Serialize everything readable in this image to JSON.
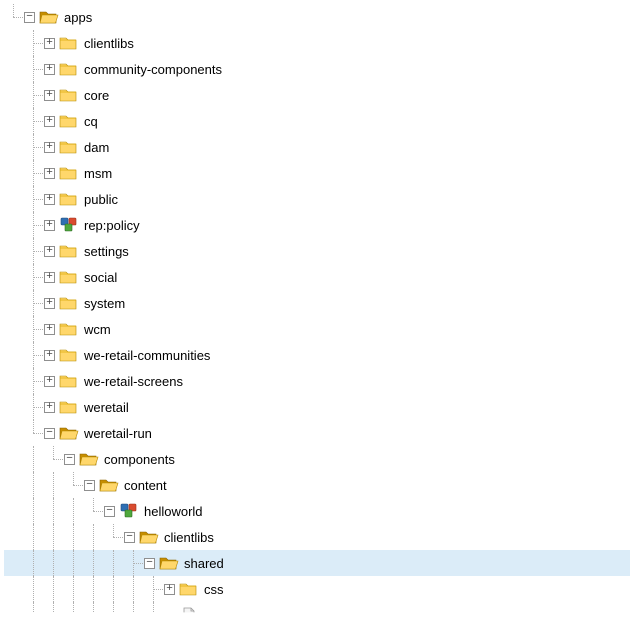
{
  "tree": [
    {
      "depth": 0,
      "toggle": "minus",
      "icon": "folder-open",
      "label": "apps",
      "guides": [],
      "join": "last"
    },
    {
      "depth": 1,
      "toggle": "plus",
      "icon": "folder",
      "label": "clientlibs",
      "guides": [
        "blank"
      ],
      "join": "tee"
    },
    {
      "depth": 1,
      "toggle": "plus",
      "icon": "folder",
      "label": "community-components",
      "guides": [
        "blank"
      ],
      "join": "tee"
    },
    {
      "depth": 1,
      "toggle": "plus",
      "icon": "folder",
      "label": "core",
      "guides": [
        "blank"
      ],
      "join": "tee"
    },
    {
      "depth": 1,
      "toggle": "plus",
      "icon": "folder",
      "label": "cq",
      "guides": [
        "blank"
      ],
      "join": "tee"
    },
    {
      "depth": 1,
      "toggle": "plus",
      "icon": "folder",
      "label": "dam",
      "guides": [
        "blank"
      ],
      "join": "tee"
    },
    {
      "depth": 1,
      "toggle": "plus",
      "icon": "folder",
      "label": "msm",
      "guides": [
        "blank"
      ],
      "join": "tee"
    },
    {
      "depth": 1,
      "toggle": "plus",
      "icon": "folder",
      "label": "public",
      "guides": [
        "blank"
      ],
      "join": "tee"
    },
    {
      "depth": 1,
      "toggle": "plus",
      "icon": "policy",
      "label": "rep:policy",
      "guides": [
        "blank"
      ],
      "join": "tee"
    },
    {
      "depth": 1,
      "toggle": "plus",
      "icon": "folder",
      "label": "settings",
      "guides": [
        "blank"
      ],
      "join": "tee"
    },
    {
      "depth": 1,
      "toggle": "plus",
      "icon": "folder",
      "label": "social",
      "guides": [
        "blank"
      ],
      "join": "tee"
    },
    {
      "depth": 1,
      "toggle": "plus",
      "icon": "folder",
      "label": "system",
      "guides": [
        "blank"
      ],
      "join": "tee"
    },
    {
      "depth": 1,
      "toggle": "plus",
      "icon": "folder",
      "label": "wcm",
      "guides": [
        "blank"
      ],
      "join": "tee"
    },
    {
      "depth": 1,
      "toggle": "plus",
      "icon": "folder",
      "label": "we-retail-communities",
      "guides": [
        "blank"
      ],
      "join": "tee"
    },
    {
      "depth": 1,
      "toggle": "plus",
      "icon": "folder",
      "label": "we-retail-screens",
      "guides": [
        "blank"
      ],
      "join": "tee"
    },
    {
      "depth": 1,
      "toggle": "plus",
      "icon": "folder",
      "label": "weretail",
      "guides": [
        "blank"
      ],
      "join": "tee"
    },
    {
      "depth": 1,
      "toggle": "minus",
      "icon": "folder-open",
      "label": "weretail-run",
      "guides": [
        "blank"
      ],
      "join": "last"
    },
    {
      "depth": 2,
      "toggle": "minus",
      "icon": "folder-open",
      "label": "components",
      "guides": [
        "blank",
        "line"
      ],
      "join": "last"
    },
    {
      "depth": 3,
      "toggle": "minus",
      "icon": "folder-open",
      "label": "content",
      "guides": [
        "blank",
        "line",
        "line"
      ],
      "join": "last"
    },
    {
      "depth": 4,
      "toggle": "minus",
      "icon": "policy",
      "label": "helloworld",
      "guides": [
        "blank",
        "line",
        "line",
        "line"
      ],
      "join": "last"
    },
    {
      "depth": 5,
      "toggle": "minus",
      "icon": "folder-open",
      "label": "clientlibs",
      "guides": [
        "blank",
        "line",
        "line",
        "line",
        "line"
      ],
      "join": "last"
    },
    {
      "depth": 6,
      "toggle": "minus",
      "icon": "folder-open",
      "label": "shared",
      "guides": [
        "blank",
        "line",
        "line",
        "line",
        "line",
        "line"
      ],
      "join": "tee",
      "selected": true
    },
    {
      "depth": 7,
      "toggle": "plus",
      "icon": "folder",
      "label": "css",
      "guides": [
        "blank",
        "line",
        "line",
        "line",
        "line",
        "line",
        "line"
      ],
      "join": "tee"
    },
    {
      "depth": 7,
      "toggle": "none",
      "icon": "file",
      "label": "",
      "guides": [
        "blank",
        "line",
        "line",
        "line",
        "line",
        "line",
        "line"
      ],
      "join": "tee",
      "cut": true
    }
  ]
}
